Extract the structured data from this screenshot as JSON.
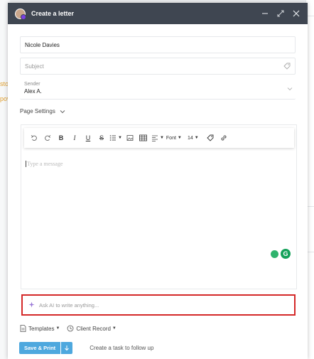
{
  "background": {
    "fragments": [
      "sto",
      "pov"
    ]
  },
  "dialog": {
    "title": "Create a letter"
  },
  "form": {
    "recipient_value": "Nicole Davies",
    "subject_placeholder": "Subject",
    "sender_label": "Sender",
    "sender_value": "Alex A.",
    "page_settings_label": "Page Settings"
  },
  "toolbar": {
    "bold_label": "B",
    "italic_label": "I",
    "underline_label": "U",
    "strike_label": "S",
    "font_label": "Font",
    "size_label": "14"
  },
  "editor": {
    "placeholder": "Type a message",
    "grammarly_label": "G"
  },
  "ai": {
    "placeholder": "Ask AI to write anything..."
  },
  "footer": {
    "templates_label": "Templates",
    "client_record_label": "Client Record",
    "save_print_label": "Save & Print",
    "follow_up_label": "Create a task to follow up"
  },
  "colors": {
    "titlebar": "#3f4651",
    "primary_button": "#4ea8de",
    "highlight_border": "#d42828",
    "grammarly": "#15a15a"
  }
}
